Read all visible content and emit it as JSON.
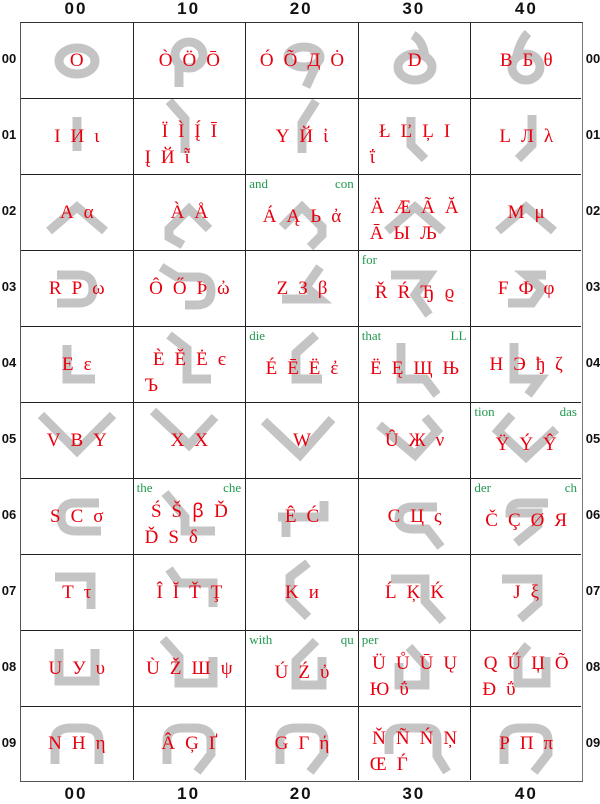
{
  "columns": [
    "00",
    "10",
    "20",
    "30",
    "40"
  ],
  "rows": [
    "00",
    "01",
    "02",
    "03",
    "04",
    "05",
    "06",
    "07",
    "08",
    "09"
  ],
  "colors": {
    "glyph": "#e8000e",
    "tag": "#1f9a4e",
    "shape": "#c4c4c4",
    "grid": "#222222"
  },
  "cells": [
    [
      {
        "shape": "o-loop",
        "lines": [
          [
            "O"
          ]
        ]
      },
      {
        "shape": "p-loop",
        "lines": [
          [
            "Ò",
            "Ö",
            "Ō"
          ]
        ]
      },
      {
        "shape": "q-loop",
        "lines": [
          [
            "Ó",
            "Õ",
            "Д",
            "Ȯ"
          ]
        ]
      },
      {
        "shape": "d-loop",
        "lines": [
          [
            "D"
          ]
        ]
      },
      {
        "shape": "b-loop",
        "lines": [
          [
            "В",
            "Б",
            "θ"
          ]
        ]
      }
    ],
    [
      {
        "shape": "i-bar",
        "lines": [
          [
            "I",
            "И",
            "ι"
          ]
        ]
      },
      {
        "shape": "i-slant-down",
        "lines": [
          [
            "Ï",
            "Ì",
            "Į́",
            "Ī"
          ],
          [
            "Į",
            "Й",
            "ῗ"
          ]
        ]
      },
      {
        "shape": "i-slant-up",
        "lines": [
          [
            "Y",
            "Й",
            "ἰ"
          ]
        ]
      },
      {
        "shape": "i-hook-right",
        "lines": [
          [
            "Ł",
            "Ľ",
            "Ļ",
            "I"
          ],
          [
            "ΐ"
          ]
        ]
      },
      {
        "shape": "i-hook-left",
        "lines": [
          [
            "L",
            "Л",
            "λ"
          ]
        ]
      }
    ],
    [
      {
        "shape": "caret",
        "lines": [
          [
            "A",
            "α"
          ]
        ]
      },
      {
        "shape": "caret-hook",
        "lines": [
          [
            "À",
            "Å"
          ]
        ]
      },
      {
        "shape": "caret-hook-right",
        "tagLeft": "and",
        "tagRight": "con",
        "lines": [
          [
            "Á",
            "Ą",
            "Ь",
            "ἀ"
          ]
        ]
      },
      {
        "shape": "caret",
        "lines": [
          [
            "Ä",
            "Æ",
            "Ã",
            "Ă"
          ],
          [
            "Ā",
            "Ы",
            "Љ"
          ]
        ]
      },
      {
        "shape": "caret",
        "lines": [
          [
            "M",
            "μ"
          ]
        ]
      }
    ],
    [
      {
        "shape": "cup-right",
        "lines": [
          [
            "R",
            "P",
            "ω"
          ]
        ]
      },
      {
        "shape": "cup-right-tail",
        "lines": [
          [
            "Ô",
            "Ő",
            "Þ",
            "ὠ"
          ]
        ]
      },
      {
        "shape": "z-hook",
        "lines": [
          [
            "Z",
            "З",
            "β"
          ]
        ]
      },
      {
        "shape": "r-hook",
        "tagLeft": "for",
        "lines": [
          [
            "Ř",
            "Ŕ",
            "Ђ",
            "ϱ"
          ]
        ]
      },
      {
        "shape": "f-hook",
        "lines": [
          [
            "F",
            "Ф",
            "φ"
          ]
        ]
      }
    ],
    [
      {
        "shape": "l-corner",
        "lines": [
          [
            "E",
            "ε"
          ]
        ]
      },
      {
        "shape": "l-slant",
        "lines": [
          [
            "È",
            "Ě",
            "Ė",
            "є"
          ],
          [
            "Ъ"
          ]
        ]
      },
      {
        "shape": "l-slant-up",
        "tagLeft": "die",
        "lines": [
          [
            "É",
            "Ē",
            "Ë",
            "ἐ"
          ]
        ]
      },
      {
        "shape": "l-corner-tail",
        "tagLeft": "that",
        "tagRight": "LL",
        "lines": [
          [
            "Ë",
            "Ę",
            "Щ",
            "Њ"
          ]
        ]
      },
      {
        "shape": "l-corner-tail-right",
        "lines": [
          [
            "H",
            "Э",
            "ђ",
            "ζ"
          ]
        ]
      }
    ],
    [
      {
        "shape": "v-shape",
        "lines": [
          [
            "V",
            "B",
            "Υ"
          ]
        ]
      },
      {
        "shape": "v-slant",
        "lines": [
          [
            "X",
            "Χ"
          ]
        ]
      },
      {
        "shape": "v-check",
        "lines": [
          [
            "W"
          ]
        ]
      },
      {
        "shape": "v-angle",
        "lines": [
          [
            "Û",
            "Ж",
            "ν"
          ]
        ]
      },
      {
        "shape": "v-hook",
        "tagLeft": "tion",
        "tagRight": "das",
        "lines": [
          [
            "Ÿ",
            "Ý",
            "Ŷ"
          ]
        ]
      }
    ],
    [
      {
        "shape": "c-shape",
        "lines": [
          [
            "S",
            "C",
            "σ"
          ]
        ]
      },
      {
        "shape": "c-slant",
        "tagLeft": "the",
        "tagRight": "che",
        "lines": [
          [
            "Ś",
            "Š",
            "ꞵ",
            "Ď"
          ],
          [
            "Ď",
            "S",
            "δ"
          ]
        ]
      },
      {
        "shape": "c-flat",
        "lines": [
          [
            "Ê",
            "Ć"
          ]
        ]
      },
      {
        "shape": "c-tail",
        "lines": [
          [
            "C",
            "Ц",
            "ς"
          ]
        ]
      },
      {
        "shape": "c-tail-bottom",
        "tagLeft": "der",
        "tagRight": "ch",
        "lines": [
          [
            "Č",
            "Ç",
            "Ø",
            "Я"
          ]
        ]
      }
    ],
    [
      {
        "shape": "t-shape",
        "lines": [
          [
            "T",
            "τ"
          ]
        ]
      },
      {
        "shape": "t-slant",
        "lines": [
          [
            "Î",
            "Ĭ",
            "Ť",
            "Ţ"
          ]
        ]
      },
      {
        "shape": "k-shape",
        "lines": [
          [
            "K",
            "ᴎ"
          ]
        ]
      },
      {
        "shape": "t-tail",
        "lines": [
          [
            "Ĺ",
            "Ķ",
            "Ḱ"
          ]
        ]
      },
      {
        "shape": "t-tail-right",
        "lines": [
          [
            "J",
            "ξ"
          ]
        ]
      }
    ],
    [
      {
        "shape": "u-shape",
        "lines": [
          [
            "U",
            "У",
            "υ"
          ]
        ]
      },
      {
        "shape": "u-slant",
        "lines": [
          [
            "Ù",
            "Ž",
            "Ш",
            "ψ"
          ]
        ]
      },
      {
        "shape": "u-hook",
        "tagLeft": "with",
        "tagRight": "qu",
        "lines": [
          [
            "Ú",
            "Ź",
            "ὐ"
          ]
        ]
      },
      {
        "shape": "u-tail",
        "tagLeft": "per",
        "lines": [
          [
            "Ü",
            "Ů",
            "Ū",
            "Ų"
          ],
          [
            "Ю",
            "ΰ"
          ]
        ]
      },
      {
        "shape": "u-tail-left",
        "lines": [
          [
            "Q",
            "Ű",
            "Џ",
            "Õ"
          ],
          [
            "Đ",
            "ΰ"
          ]
        ]
      }
    ],
    [
      {
        "shape": "n-shape",
        "lines": [
          [
            "N",
            "H",
            "η"
          ]
        ]
      },
      {
        "shape": "n-tail",
        "lines": [
          [
            "Â",
            "Ģ",
            "Ґ"
          ]
        ]
      },
      {
        "shape": "n-tail",
        "lines": [
          [
            "G",
            "Γ",
            "ή"
          ]
        ]
      },
      {
        "shape": "n-tail-right",
        "lines": [
          [
            "Ň",
            "Ñ",
            "Ń",
            "Ņ"
          ],
          [
            "Œ",
            "Ѓ"
          ]
        ]
      },
      {
        "shape": "n-tail",
        "lines": [
          [
            "P",
            "П",
            "π"
          ]
        ]
      }
    ]
  ]
}
